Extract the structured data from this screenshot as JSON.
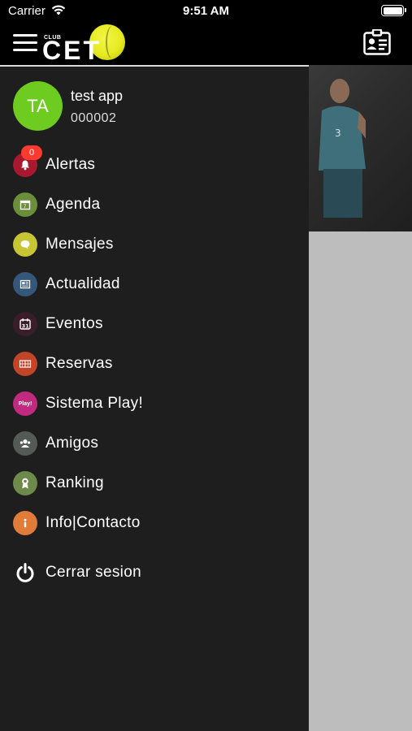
{
  "status_bar": {
    "carrier": "Carrier",
    "time": "9:51 AM"
  },
  "header": {
    "logo_club": "CLUB",
    "logo_name": "CET",
    "menu_icon": "hamburger-icon",
    "card_icon": "id-card-icon"
  },
  "profile": {
    "initials": "TA",
    "name": "test app",
    "member_id": "000002",
    "avatar_color": "#6ecb1f"
  },
  "menu": {
    "items": [
      {
        "label": "Alertas",
        "icon": "bell-icon",
        "color": "#a8192f",
        "badge": "0"
      },
      {
        "label": "Agenda",
        "icon": "calendar-icon",
        "color": "#6b8e3a"
      },
      {
        "label": "Mensajes",
        "icon": "chat-icon",
        "color": "#c8c534"
      },
      {
        "label": "Actualidad",
        "icon": "newspaper-icon",
        "color": "#35577a"
      },
      {
        "label": "Eventos",
        "icon": "event-calendar-icon",
        "color": "#3a1d29"
      },
      {
        "label": "Reservas",
        "icon": "court-icon",
        "color": "#c2452a"
      },
      {
        "label": "Sistema Play!",
        "icon": "play-badge-icon",
        "color": "#c12a7e",
        "icon_text": "Play!"
      },
      {
        "label": "Amigos",
        "icon": "friends-icon",
        "color": "#545a55"
      },
      {
        "label": "Ranking",
        "icon": "medal-icon",
        "color": "#6d8a4a"
      },
      {
        "label": "Info|Contacto",
        "icon": "info-icon",
        "color": "#e07b3a"
      }
    ],
    "logout": {
      "label": "Cerrar sesion",
      "icon": "power-icon"
    }
  }
}
